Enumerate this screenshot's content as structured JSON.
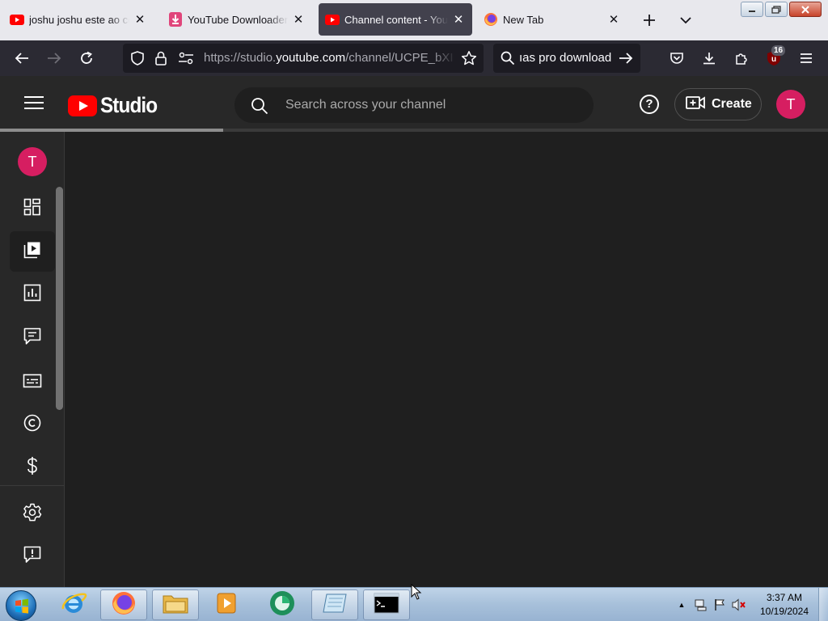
{
  "browser": {
    "tabs": [
      {
        "title": "joshu joshu este ao co",
        "favicon": "youtube-icon",
        "active": false
      },
      {
        "title": "YouTube Downloader",
        "favicon": "download-icon",
        "active": false
      },
      {
        "title": "Channel content - YouTube",
        "favicon": "youtube-icon",
        "active": true
      },
      {
        "title": "New Tab",
        "favicon": "firefox-icon",
        "active": false
      }
    ],
    "new_tab_label": "+",
    "tab_list_label": "⌄",
    "url_prefix": "https://studio.",
    "url_domain": "youtube.com",
    "url_path": "/channel/UCPE_bXI",
    "search_text": "ıas pro download",
    "extensions_badge": "16"
  },
  "studio": {
    "logo_text": "Studio",
    "search_placeholder": "Search across your channel",
    "create_label": "Create",
    "avatar_initial": "T",
    "loading_progress": 0.27,
    "sidebar_items": [
      {
        "name": "dashboard",
        "icon": "dashboard-icon",
        "active": false
      },
      {
        "name": "content",
        "icon": "content-icon",
        "active": true
      },
      {
        "name": "analytics",
        "icon": "analytics-icon",
        "active": false
      },
      {
        "name": "comments",
        "icon": "comments-icon",
        "active": false
      },
      {
        "name": "subtitles",
        "icon": "subtitles-icon",
        "active": false
      },
      {
        "name": "copyright",
        "icon": "copyright-icon",
        "active": false
      },
      {
        "name": "earn",
        "icon": "dollar-icon",
        "active": false
      },
      {
        "name": "settings",
        "icon": "gear-icon",
        "active": false
      },
      {
        "name": "send-feedback",
        "icon": "feedback-icon",
        "active": false
      }
    ]
  },
  "taskbar": {
    "pinned": [
      "internet-explorer-icon",
      "firefox-icon",
      "file-explorer-icon",
      "media-player-icon",
      "green-app-icon",
      "notepad-icon",
      "command-prompt-icon"
    ],
    "time": "3:37 AM",
    "date": "10/19/2024",
    "tray_expand": "▲"
  },
  "colors": {
    "brand_red": "#ff0000",
    "avatar_pink": "#d61e61",
    "studio_bg": "#1f1f1f",
    "header_bg": "#282828"
  }
}
